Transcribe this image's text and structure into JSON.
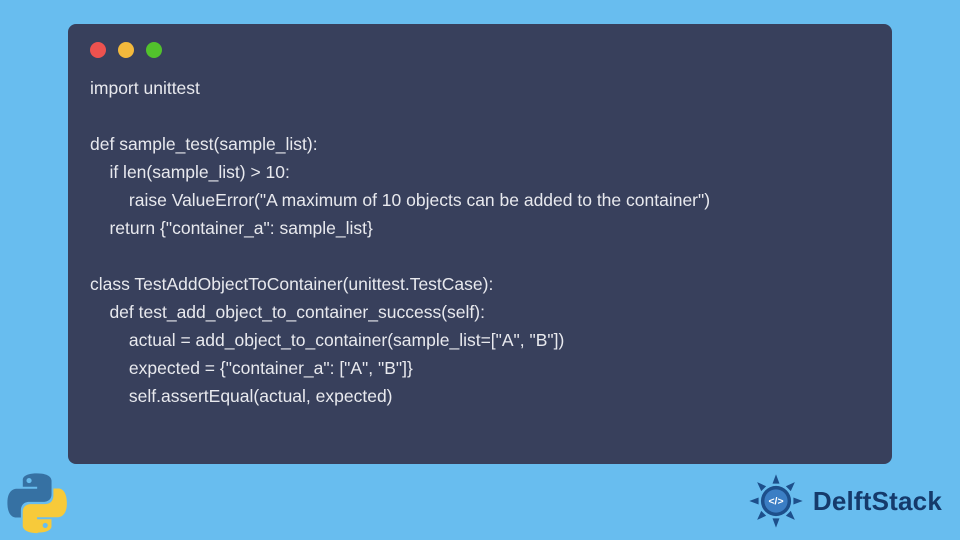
{
  "code": {
    "lines": [
      "import unittest",
      "",
      "def sample_test(sample_list):",
      "    if len(sample_list) > 10:",
      "        raise ValueError(\"A maximum of 10 objects can be added to the container\")",
      "    return {\"container_a\": sample_list}",
      "",
      "class TestAddObjectToContainer(unittest.TestCase):",
      "    def test_add_object_to_container_success(self):",
      "        actual = add_object_to_container(sample_list=[\"A\", \"B\"])",
      "        expected = {\"container_a\": [\"A\", \"B\"]}",
      "        self.assertEqual(actual, expected)"
    ]
  },
  "brand": {
    "name": "DelftStack"
  },
  "traffic_lights": {
    "red": "#ed524f",
    "yellow": "#f3b93c",
    "green": "#52c22c"
  }
}
